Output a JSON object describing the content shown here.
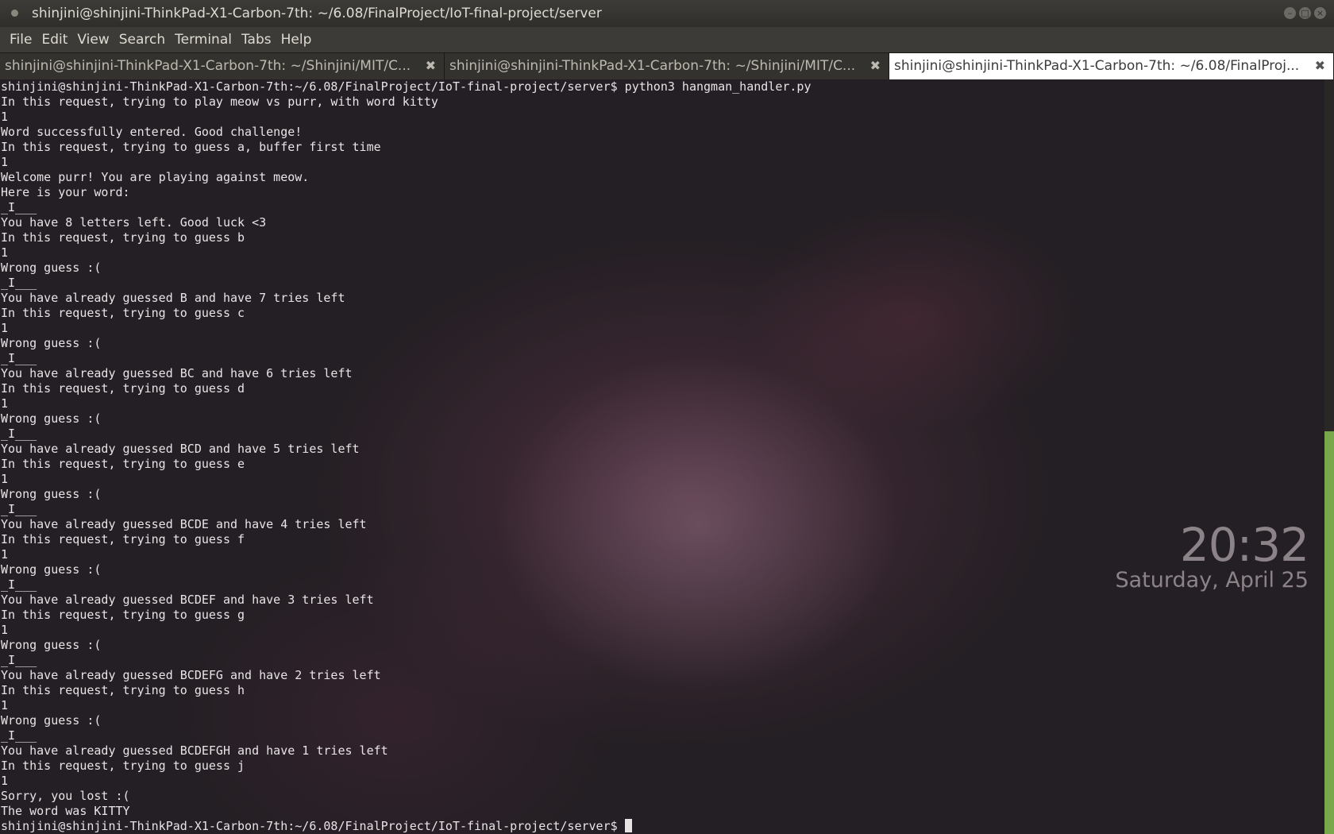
{
  "window": {
    "title": "shinjini@shinjini-ThinkPad-X1-Carbon-7th: ~/6.08/FinalProject/IoT-final-project/server"
  },
  "menu": [
    "File",
    "Edit",
    "View",
    "Search",
    "Terminal",
    "Tabs",
    "Help"
  ],
  "tabs": [
    {
      "label": "shinjini@shinjini-ThinkPad-X1-Carbon-7th: ~/Shinjini/MIT/C...",
      "active": false
    },
    {
      "label": "shinjini@shinjini-ThinkPad-X1-Carbon-7th: ~/Shinjini/MIT/C...",
      "active": false
    },
    {
      "label": "shinjini@shinjini-ThinkPad-X1-Carbon-7th: ~/6.08/FinalProj...",
      "active": true
    }
  ],
  "terminal": {
    "lines": [
      "shinjini@shinjini-ThinkPad-X1-Carbon-7th:~/6.08/FinalProject/IoT-final-project/server$ python3 hangman_handler.py",
      "In this request, trying to play meow vs purr, with word kitty",
      "1",
      "Word successfully entered. Good challenge!",
      "In this request, trying to guess a, buffer first time",
      "1",
      "Welcome purr! You are playing against meow.",
      "Here is your word:",
      "_I___",
      "You have 8 letters left. Good luck <3",
      "In this request, trying to guess b",
      "1",
      "Wrong guess :(",
      "_I___",
      "You have already guessed B and have 7 tries left",
      "In this request, trying to guess c",
      "1",
      "Wrong guess :(",
      "_I___",
      "You have already guessed BC and have 6 tries left",
      "In this request, trying to guess d",
      "1",
      "Wrong guess :(",
      "_I___",
      "You have already guessed BCD and have 5 tries left",
      "In this request, trying to guess e",
      "1",
      "Wrong guess :(",
      "_I___",
      "You have already guessed BCDE and have 4 tries left",
      "In this request, trying to guess f",
      "1",
      "Wrong guess :(",
      "_I___",
      "You have already guessed BCDEF and have 3 tries left",
      "In this request, trying to guess g",
      "1",
      "Wrong guess :(",
      "_I___",
      "You have already guessed BCDEFG and have 2 tries left",
      "In this request, trying to guess h",
      "1",
      "Wrong guess :(",
      "_I___",
      "You have already guessed BCDEFGH and have 1 tries left",
      "In this request, trying to guess j",
      "1",
      "Sorry, you lost :(",
      "The word was KITTY"
    ],
    "prompt": "shinjini@shinjini-ThinkPad-X1-Carbon-7th:~/6.08/FinalProject/IoT-final-project/server$ "
  },
  "desktop_clock": {
    "time": "20:32",
    "date": "Saturday, April 25"
  },
  "colors": {
    "scrollbar_thumb": "#77a94c",
    "text": "#e8e4e6"
  }
}
